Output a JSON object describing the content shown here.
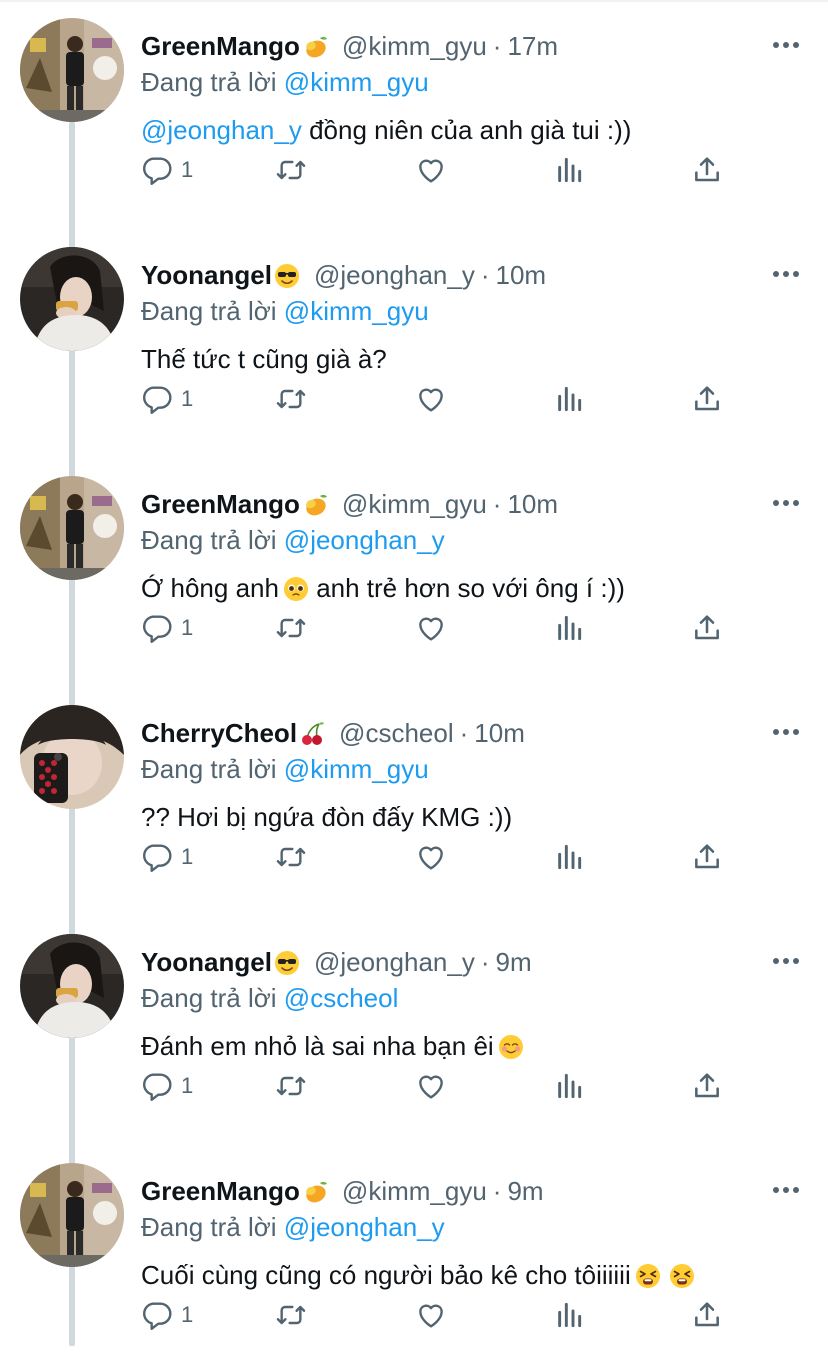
{
  "colors": {
    "link": "#1d9bf0",
    "muted": "#536471",
    "text": "#0f1419",
    "thread": "#cfd9de"
  },
  "tweets": [
    {
      "name": "GreenMango",
      "name_emoji": "mango",
      "handle": "@kimm_gyu",
      "sep": "·",
      "time": "17m",
      "reply_prefix": "Đang trả lời",
      "reply_to": "@kimm_gyu",
      "text_mention": "@jeonghan_y",
      "text": " đồng niên của anh già tui :))",
      "text_emojis": [],
      "reply_count": "1",
      "avatar": "person-street-mural"
    },
    {
      "name": "Yoonangel",
      "name_emoji": "sunglasses",
      "handle": "@jeonghan_y",
      "sep": "·",
      "time": "10m",
      "reply_prefix": "Đang trả lời",
      "reply_to": "@kimm_gyu",
      "text_mention": "",
      "text": "Thế tức t cũng già à?",
      "text_emojis": [],
      "reply_count": "1",
      "avatar": "person-eating"
    },
    {
      "name": "GreenMango",
      "name_emoji": "mango",
      "handle": "@kimm_gyu",
      "sep": "·",
      "time": "10m",
      "reply_prefix": "Đang trả lời",
      "reply_to": "@jeonghan_y",
      "text_mention": "",
      "text": "Ớ hông anh",
      "text_emojis": [
        "pleading"
      ],
      "text_after": " anh trẻ hơn so với ông í :))",
      "reply_count": "1",
      "avatar": "person-street-mural"
    },
    {
      "name": "CherryCheol",
      "name_emoji": "cherries",
      "handle": "@cscheol",
      "sep": "·",
      "time": "10m",
      "reply_prefix": "Đang trả lời",
      "reply_to": "@kimm_gyu",
      "text_mention": "",
      "text": "?? Hơi bị ngứa đòn đấy KMG :))",
      "text_emojis": [],
      "reply_count": "1",
      "avatar": "person-phone-selfie"
    },
    {
      "name": "Yoonangel",
      "name_emoji": "sunglasses",
      "handle": "@jeonghan_y",
      "sep": "·",
      "time": "9m",
      "reply_prefix": "Đang trả lời",
      "reply_to": "@cscheol",
      "text_mention": "",
      "text": "Đánh em nhỏ là sai nha bạn êi",
      "text_emojis": [
        "smiling"
      ],
      "reply_count": "1",
      "avatar": "person-eating"
    },
    {
      "name": "GreenMango",
      "name_emoji": "mango",
      "handle": "@kimm_gyu",
      "sep": "·",
      "time": "9m",
      "reply_prefix": "Đang trả lời",
      "reply_to": "@jeonghan_y",
      "text_mention": "",
      "text": "Cuối cùng cũng có người bảo kê cho tôiiiiii",
      "text_emojis": [
        "tired",
        "tired"
      ],
      "reply_count": "1",
      "avatar": "person-street-mural"
    }
  ],
  "actions": [
    "reply-icon",
    "retweet-icon",
    "like-icon",
    "analytics-icon",
    "share-icon"
  ],
  "more_icon": "more-icon"
}
